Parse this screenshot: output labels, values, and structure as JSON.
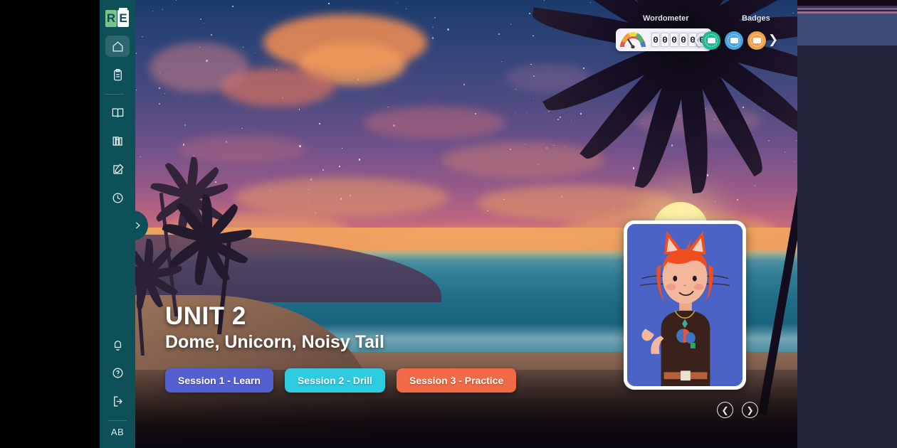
{
  "app": {
    "logo_r": "R",
    "logo_e": "E",
    "user_initials": "AB"
  },
  "sidebar": {
    "items": [
      {
        "name": "home",
        "icon": "home-icon",
        "label": "Home",
        "active": true
      },
      {
        "name": "clipboard",
        "icon": "clipboard-icon",
        "label": "Assignments",
        "active": false
      },
      {
        "name": "book",
        "icon": "book-icon",
        "label": "Library",
        "active": false
      },
      {
        "name": "library",
        "icon": "books-icon",
        "label": "Resources",
        "active": false
      },
      {
        "name": "edit",
        "icon": "pencil-square-icon",
        "label": "Practice",
        "active": false
      },
      {
        "name": "history",
        "icon": "clock-icon",
        "label": "History",
        "active": false
      },
      {
        "name": "notify",
        "icon": "bell-icon",
        "label": "Notifications",
        "active": false
      },
      {
        "name": "help",
        "icon": "question-circle-icon",
        "label": "Help",
        "active": false
      },
      {
        "name": "logout",
        "icon": "logout-icon",
        "label": "Log out",
        "active": false
      }
    ],
    "toggle_icon": "chevron-right-icon",
    "color": "#0e5058"
  },
  "header": {
    "wordometer_label": "Wordometer",
    "wordometer_icon": "gauge-icon",
    "wordometer_digits": [
      "0",
      "0",
      "0",
      "0",
      "0",
      "0"
    ],
    "badges_label": "Badges",
    "badge_prev_icon": "chevron-left-icon",
    "badge_next_icon": "chevron-right-icon",
    "badges": [
      {
        "name": "badge-green",
        "color": "#1fb894"
      },
      {
        "name": "badge-blue",
        "color": "#4aa3e0"
      },
      {
        "name": "badge-orange",
        "color": "#efa14a"
      }
    ]
  },
  "unit": {
    "title": "UNIT 2",
    "subtitle": "Dome, Unicorn, Noisy Tail",
    "sessions": [
      {
        "label": "Session 1 - Learn",
        "color": "#5560d0"
      },
      {
        "label": "Session 2 - Drill",
        "color": "#2fcbe0"
      },
      {
        "label": "Session 3 - Practice",
        "color": "#ef6a45"
      }
    ]
  },
  "avatar": {
    "name": "student-avatar",
    "background_color": "#4a63c4",
    "hair_color": "#f04e21",
    "skin_color": "#f3b79b",
    "shirt_color": "#3a211c"
  },
  "pager": {
    "prev_icon": "chevron-left-circle-icon",
    "next_icon": "chevron-right-circle-icon"
  },
  "colors": {
    "sidebar": "#0e5058",
    "right_panel": "#212339",
    "right_band": "#3c4c76",
    "sun": "#fbeda0"
  }
}
